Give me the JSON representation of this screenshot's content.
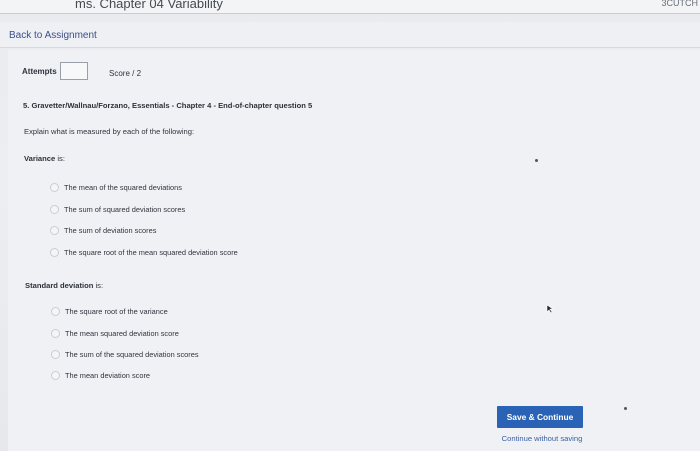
{
  "header": {
    "title": "ms. Chapter 04 Variability",
    "right_text": "3CUTCH"
  },
  "nav": {
    "back_label": "Back to Assignment"
  },
  "meta": {
    "attempts_label": "Attempts",
    "score_label": "Score / 2"
  },
  "question": {
    "heading": "5. Gravetter/Wallnau/Forzano, Essentials - Chapter 4 - End-of-chapter question 5",
    "prompt": "Explain what is measured by each of the following:"
  },
  "sections": [
    {
      "label": "Variance",
      "suffix": " is:",
      "options": [
        "The mean of the squared deviations",
        "The sum of squared deviation scores",
        "The sum of deviation scores",
        "The square root of the mean squared deviation score"
      ]
    },
    {
      "label": "Standard deviation",
      "suffix": " is:",
      "options": [
        "The square root of the variance",
        "The mean squared deviation score",
        "The sum of the squared deviation scores",
        "The mean deviation score"
      ]
    }
  ],
  "actions": {
    "save_label": "Save & Continue",
    "continue_label": "Continue without saving"
  },
  "colors": {
    "primary": "#2a63b5",
    "link": "#3b4f8c",
    "background": "#eceef1"
  },
  "icons": {
    "cursor": "mouse-pointer-icon"
  }
}
